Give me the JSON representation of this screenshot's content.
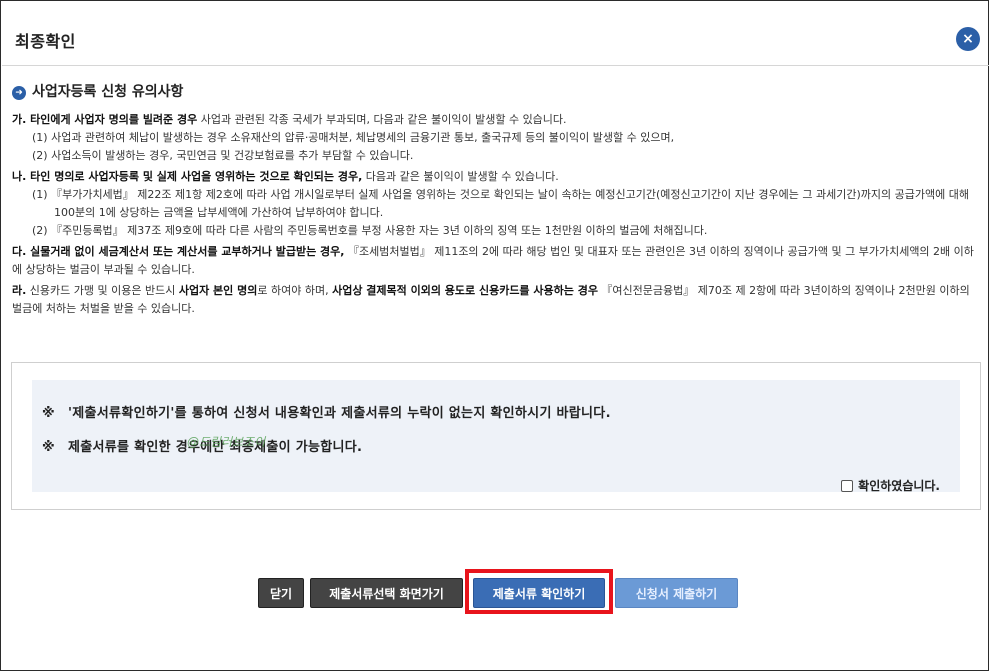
{
  "dialog": {
    "title": "최종확인",
    "close_label": "×"
  },
  "section": {
    "bullet": "➜",
    "title": "사업자등록 신청 유의사항"
  },
  "notes": {
    "ga_bold": "가. 타인에게 사업자 명의를 빌려준 경우",
    "ga_text": " 사업과 관련된 각종 국세가 부과되며, 다음과 같은 불이익이 발생할 수 있습니다.",
    "ga_1": "(1) 사업과 관련하여 체납이 발생하는 경우 소유재산의 압류·공매처분, 체납명세의 금융기관 통보, 출국규제 등의 불이익이 발생할 수 있으며,",
    "ga_2": "(2) 사업소득이 발생하는 경우, 국민연금 및 건강보험료를 추가 부담할 수 있습니다.",
    "na_bold": "나. 타인 명의로 사업자등록 및 실제 사업을 영위하는 것으로 확인되는 경우,",
    "na_text": " 다음과 같은 불이익이 발생할 수 있습니다.",
    "na_1": "(1) 『부가가치세법』 제22조 제1항 제2호에 따라 사업 개시일로부터 실제 사업을 영위하는 것으로 확인되는 날이 속하는 예정신고기간(예정신고기간이 지난 경우에는 그 과세기간)까지의 공급가액에 대해 100분의 1에 상당하는 금액을 납부세액에 가산하여 납부하여야 합니다.",
    "na_2": "(2) 『주민등록법』 제37조 제9호에 따라 다른 사람의 주민등록번호를 부정 사용한 자는 3년 이하의 징역 또는 1천만원 이하의 벌금에 처해집니다.",
    "da_bold": "다. 실물거래 없이 세금계산서 또는 계산서를 교부하거나 발급받는 경우,",
    "da_text": " 『조세범처벌법』 제11조의 2에 따라 해당 법인 및 대표자 또는 관련인은 3년 이하의 징역이나 공급가액 및 그 부가가치세액의 2배 이하에 상당하는 벌금이 부과될 수 있습니다.",
    "ra_prefix": "라.",
    "ra_text1": " 신용카드 가맹 및 이용은 반드시 ",
    "ra_bold1": "사업자 본인 명의",
    "ra_text2": "로 하여야 하며, ",
    "ra_bold2": "사업상 결제목적 이외의 용도로 신용카드를 사용하는 경우",
    "ra_text3": " 『여신전문금융법』 제70조 제 2항에 따라 3년이하의 징역이나 2천만원 이하의 벌금에 처하는 처벌을 받을 수 있습니다."
  },
  "confirm": {
    "mark": "※",
    "line1": "'제출서류확인하기'를 통하여 신청서 내용확인과 제출서류의 누락이 없는지 확인하시기 바랍니다.",
    "line2": "제출서류를 확인한 경우에만 최종제출이 가능합니다.",
    "watermark": "@드림러브조이",
    "checkbox_label": "확인하였습니다.",
    "checkbox_checked": false
  },
  "buttons": {
    "close": "닫기",
    "goto_select": "제출서류선택 화면가기",
    "confirm_docs": "제출서류 확인하기",
    "submit": "신청서 제출하기"
  },
  "colors": {
    "accent": "#2b5fa7",
    "highlight": "#e8141c",
    "dark_button": "#444444",
    "disabled_button": "#6b9ad6"
  }
}
